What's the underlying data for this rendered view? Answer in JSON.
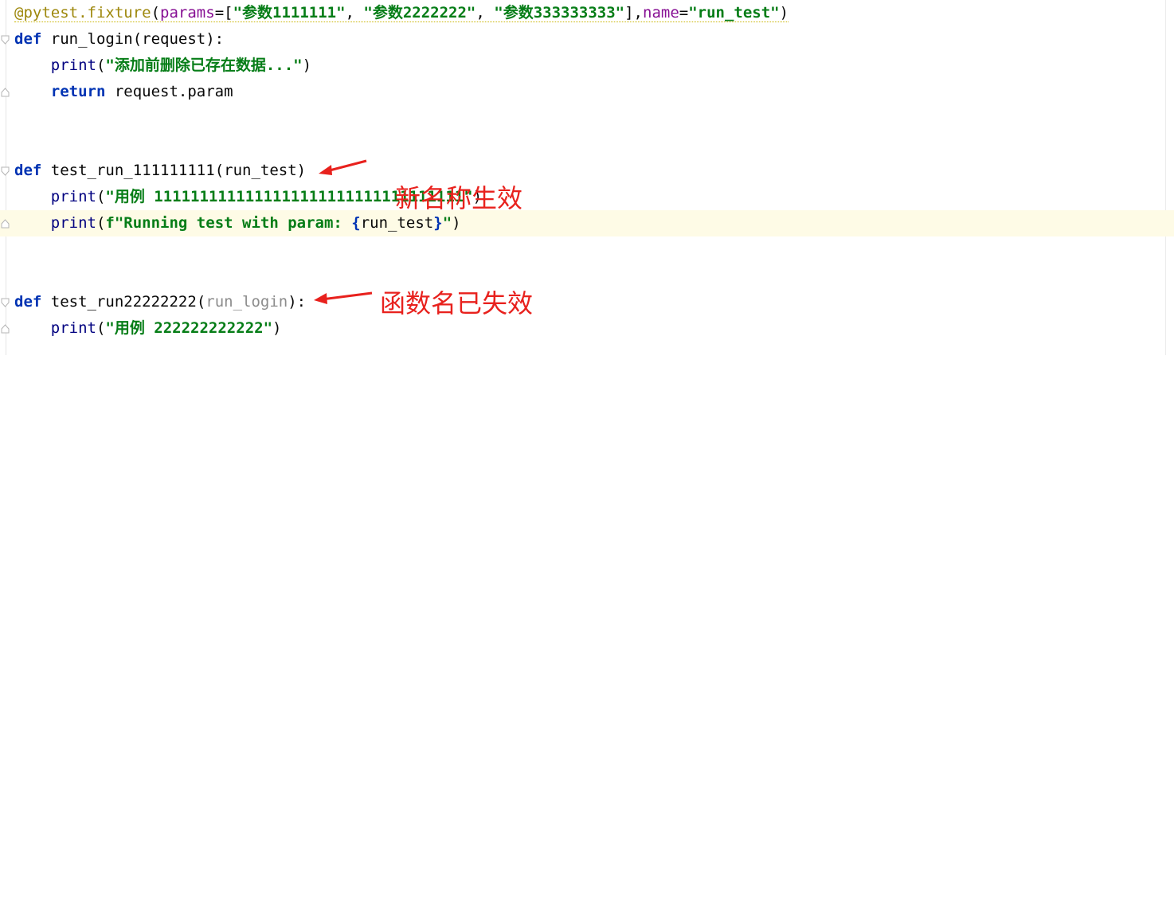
{
  "editor": {
    "line1": {
      "decorator": "@pytest.fixture",
      "open": "(",
      "params_kw": "params",
      "eq": "=[",
      "s1": "\"参数1111111\"",
      "c1": ", ",
      "s2": "\"参数2222222\"",
      "c2": ", ",
      "s3": "\"参数333333333\"",
      "close_list": "],",
      "name_kw": "name",
      "eq2": "=",
      "s4": "\"run_test\"",
      "close": ")"
    },
    "line2": {
      "kw": "def",
      "name": "run_login",
      "args": "(request):"
    },
    "line3": {
      "fn": "print",
      "open": "(",
      "str": "\"添加前删除已存在数据...\"",
      "close": ")"
    },
    "line4": {
      "kw": "return",
      "rest": " request.param"
    },
    "line5": {
      "kw": "def",
      "name": "test_run_111111111",
      "args": "(run_test)"
    },
    "line6": {
      "fn": "print",
      "open": "(",
      "str": "\"用例 1111111111111111111111111111111111\"",
      "close": ")"
    },
    "line7": {
      "fn": "print",
      "open": "(",
      "fstr_a": "f\"Running test with param: ",
      "brace_open": "{",
      "var": "run_test",
      "brace_close": "}",
      "fstr_b": "\"",
      "close": ")"
    },
    "line8": {
      "kw": "def",
      "name": "test_run22222222",
      "open": "(",
      "arg": "run_login",
      "close": "):"
    },
    "line9": {
      "fn": "print",
      "open": "(",
      "str": "\"用例 222222222222\"",
      "close": ")"
    }
  },
  "annotations": {
    "new_name_effective": "新名称生效",
    "func_name_invalid": "函数名已失效"
  },
  "colors": {
    "annotation": "#e8211d",
    "keyword": "#0033b3",
    "string": "#067d17",
    "highlight": "#fefbe6"
  }
}
